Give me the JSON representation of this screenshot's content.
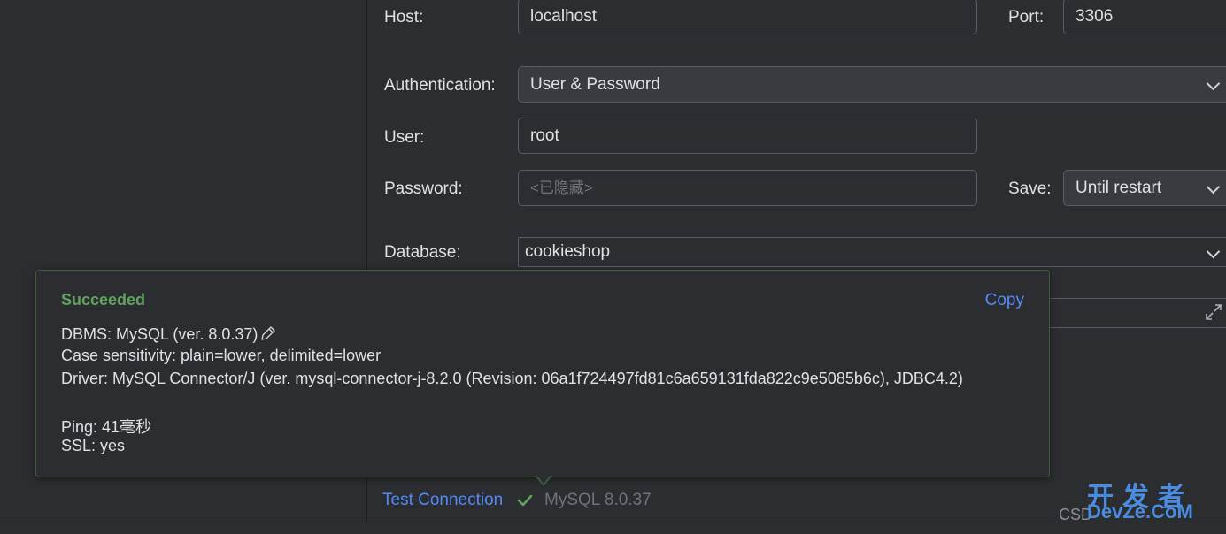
{
  "form": {
    "host_label": "Host:",
    "host_value": "localhost",
    "port_label": "Port:",
    "port_value": "3306",
    "auth_label": "Authentication:",
    "auth_value": "User & Password",
    "user_label": "User:",
    "user_value": "root",
    "password_label": "Password:",
    "password_placeholder": "<已隐藏>",
    "save_label": "Save:",
    "save_value": "Until restart",
    "database_label": "Database:",
    "database_value": "cookieshop"
  },
  "popup": {
    "title": "Succeeded",
    "copy_label": "Copy",
    "dbms": "DBMS: MySQL (ver. 8.0.37)",
    "case_sensitivity": "Case sensitivity: plain=lower, delimited=lower",
    "driver": "Driver: MySQL Connector/J (ver. mysql-connector-j-8.2.0 (Revision: 06a1f724497fd81c6a659131fda822c9e5085b6c), JDBC4.2)",
    "ping": "Ping: 41毫秒",
    "ssl": "SSL: yes"
  },
  "footer": {
    "test_connection_label": "Test Connection",
    "status_text": "MySQL 8.0.37"
  },
  "watermark": {
    "csd": "CSD",
    "big": "开发者",
    "small": "DevZe.CoM"
  },
  "colors": {
    "success": "#5fa35d",
    "link": "#548af7",
    "background": "#2b2d30"
  }
}
